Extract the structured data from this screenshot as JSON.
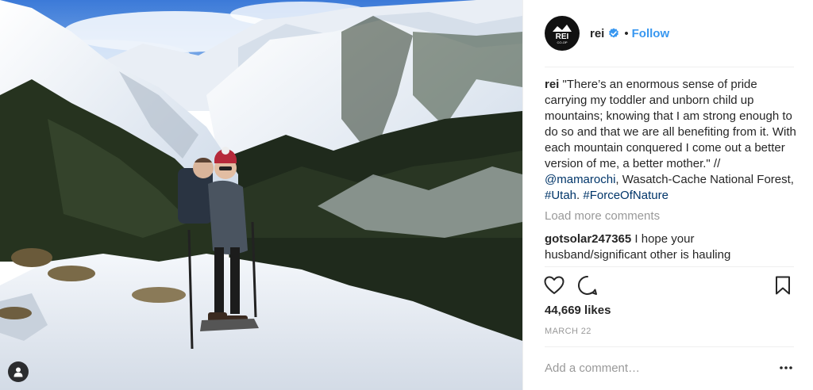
{
  "post": {
    "username": "rei",
    "follow_label": "Follow",
    "separator": "•",
    "logo_text": "REI",
    "logo_subtext": "CO-OP",
    "caption": {
      "author": "rei",
      "text_1": " \"There’s an enormous sense of pride carrying my toddler and unborn child up mountains; knowing that I am strong enough to do so and that we are all benefiting from it. With each mountain conquered I come out a better version of me, a better mother.\" // ",
      "mention": "@mamarochi",
      "text_2": ", Wasatch-Cache National Forest, ",
      "hashtag_1": "#Utah",
      "text_3": ". ",
      "hashtag_2": "#ForceOfNature"
    },
    "load_more_label": "Load more comments",
    "comments": [
      {
        "author": "gotsolar247365",
        "text": " I hope your husband/significant other is hauling"
      }
    ],
    "likes": "44,669 likes",
    "date": "MARCH 22",
    "add_comment_placeholder": "Add a comment…"
  },
  "icons": {
    "like": "heart-icon",
    "comment": "comment-bubble-icon",
    "save": "bookmark-icon",
    "more": "more-options-icon",
    "verified": "verified-badge-icon",
    "user_tag": "user-tag-icon"
  },
  "colors": {
    "link_blue": "#3897f0",
    "hashtag_blue": "#003569",
    "text": "#262626",
    "muted": "#999999"
  }
}
